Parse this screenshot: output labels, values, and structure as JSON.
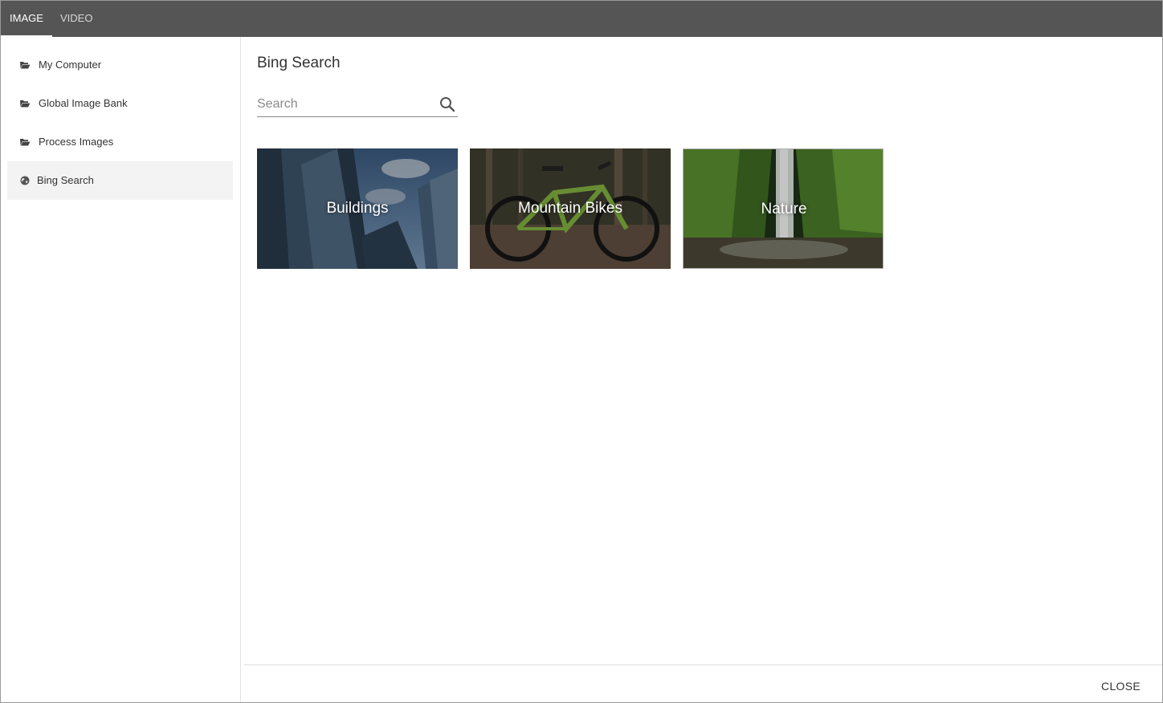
{
  "tabs": [
    {
      "label": "IMAGE",
      "active": true
    },
    {
      "label": "VIDEO",
      "active": false
    }
  ],
  "sidebar": {
    "items": [
      {
        "label": "My Computer",
        "icon": "folder-open-icon",
        "selected": false
      },
      {
        "label": "Global Image Bank",
        "icon": "folder-open-icon",
        "selected": false
      },
      {
        "label": "Process Images",
        "icon": "folder-open-icon",
        "selected": false
      },
      {
        "label": "Bing Search",
        "icon": "globe-icon",
        "selected": true
      }
    ]
  },
  "main": {
    "title": "Bing Search",
    "search": {
      "placeholder": "Search",
      "value": ""
    },
    "categories": [
      {
        "label": "Buildings"
      },
      {
        "label": "Mountain Bikes"
      },
      {
        "label": "Nature"
      }
    ]
  },
  "footer": {
    "close_label": "CLOSE"
  },
  "colors": {
    "topbar": "#555555",
    "selected_item": "#f3f3f3",
    "text": "#333333"
  }
}
